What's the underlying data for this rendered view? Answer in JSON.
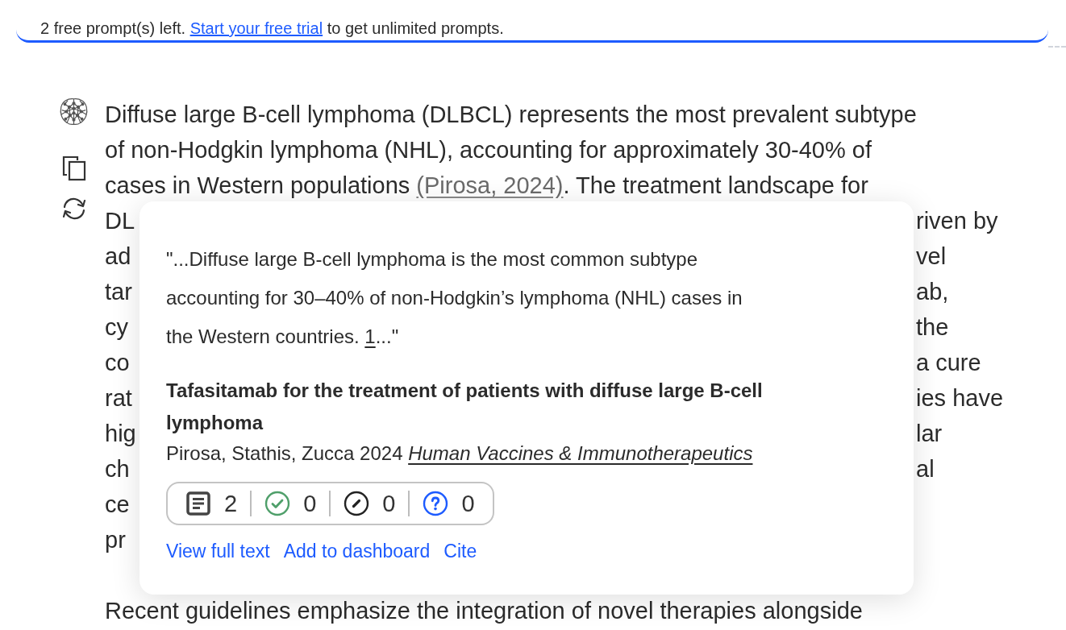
{
  "banner": {
    "segments": [
      {
        "kind": "text",
        "text": "2 free prompt(s) left. "
      },
      {
        "kind": "link",
        "text": "Start your free trial"
      },
      {
        "kind": "text",
        "text": " to get unlimited prompts."
      }
    ]
  },
  "answer": {
    "lines": [
      [
        {
          "kind": "text",
          "text": "Diffuse large B-cell lymphoma (DLBCL) represents the most prevalent subtype"
        }
      ],
      [
        {
          "kind": "text",
          "text": "of non-Hodgkin lymphoma (NHL), accounting for approximately 30-40% of"
        }
      ],
      [
        {
          "kind": "text",
          "text": "cases in Western populations "
        },
        {
          "kind": "citation",
          "text": "(Pirosa, 2024)"
        },
        {
          "kind": "text",
          "text": ". The treatment landscape for"
        }
      ]
    ],
    "fragment_rows": [
      {
        "left": "DL",
        "right": "riven by"
      },
      {
        "left": "ad",
        "right": "vel"
      },
      {
        "left": "tar",
        "right": "ab,"
      },
      {
        "left": "cy",
        "right": "the"
      },
      {
        "left": "co",
        "right": "a cure"
      },
      {
        "left": "rat",
        "right": "ies have"
      },
      {
        "left": "hig",
        "right": "lar"
      },
      {
        "left": "ch",
        "right": "al"
      },
      {
        "left": "ce"
      },
      {
        "left": "pr"
      }
    ],
    "next_paragraph": "Recent guidelines emphasize the integration of novel therapies alongside"
  },
  "source_popup": {
    "quote_lines": [
      [
        {
          "kind": "text",
          "text": "\"...Diffuse large B-cell lymphoma is the most common subtype"
        }
      ],
      [
        {
          "kind": "text",
          "text": "accounting for 30–40% of non-Hodgkin’s lymphoma (NHL) cases in"
        }
      ],
      [
        {
          "kind": "text",
          "text": "the Western countries. "
        },
        {
          "kind": "footnote",
          "text": "1"
        },
        {
          "kind": "text",
          "text": "...\""
        }
      ]
    ],
    "title": "Tafasitamab for the treatment of patients with diffuse large B-cell lymphoma",
    "authors": "Pirosa, Stathis, Zucca 2024",
    "journal": "Human Vaccines & Immunotherapeutics",
    "stats": [
      {
        "kind": "document",
        "count": "2"
      },
      {
        "kind": "check",
        "count": "0"
      },
      {
        "kind": "slash",
        "count": "0"
      },
      {
        "kind": "question",
        "count": "0"
      }
    ],
    "actions": [
      "View full text",
      "Add to dashboard",
      "Cite"
    ]
  }
}
